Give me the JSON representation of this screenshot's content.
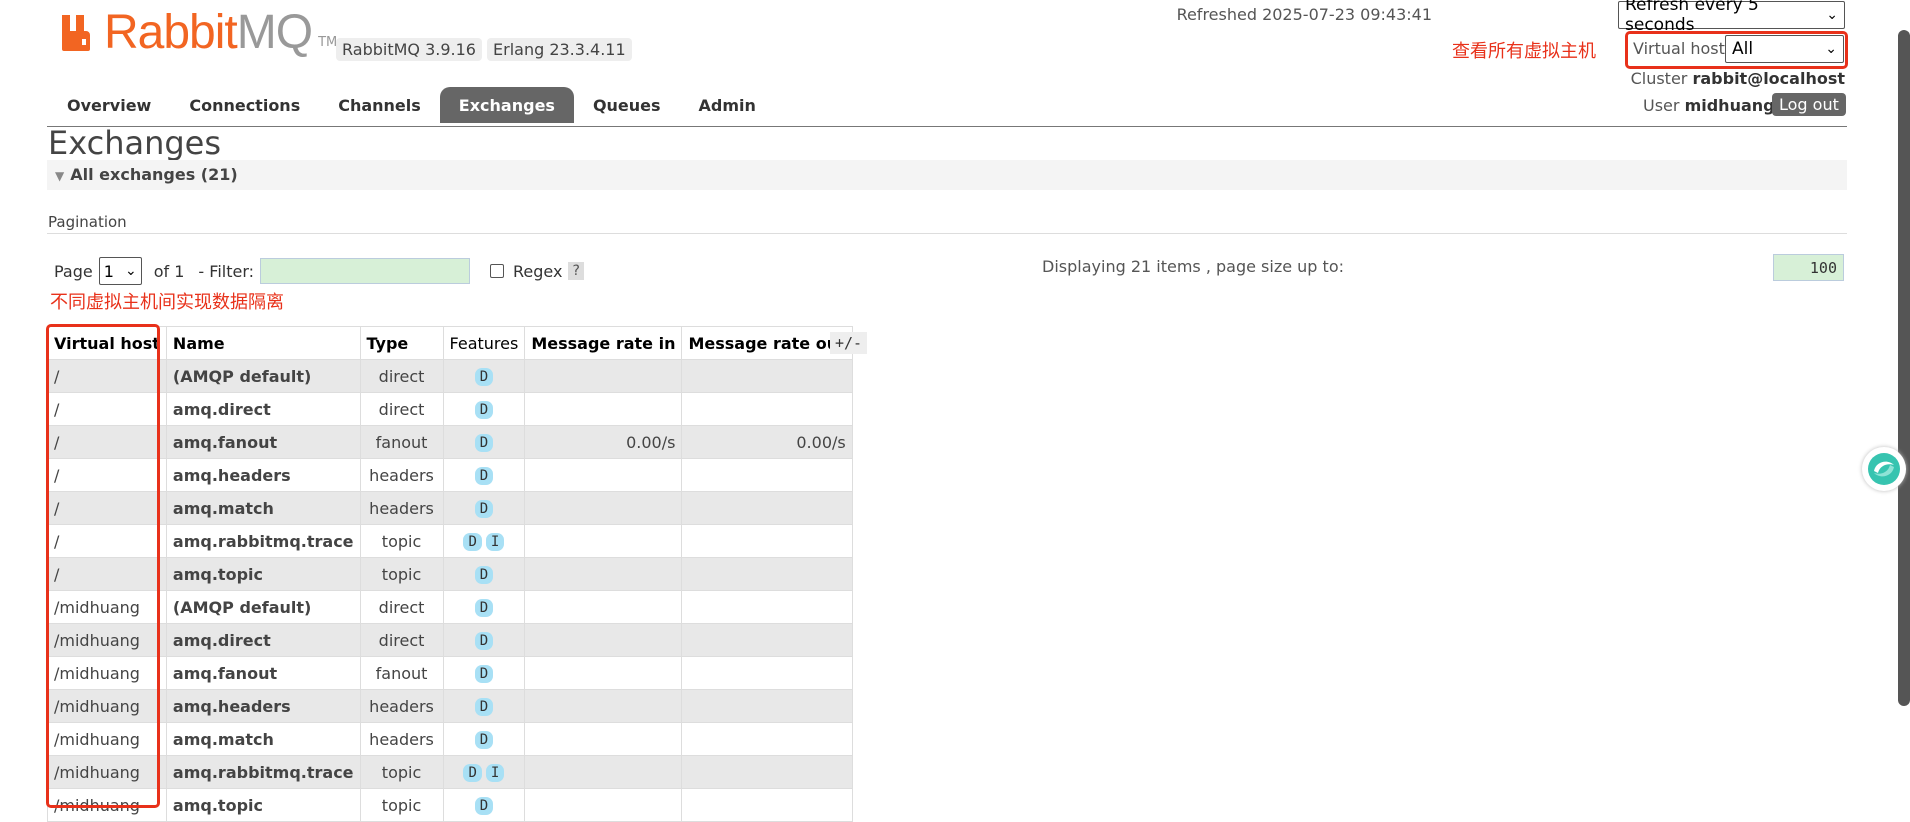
{
  "app": {
    "logo_prefix": "Rabbit",
    "logo_suffix": "MQ",
    "logo_tm": "TM",
    "version_badge": "RabbitMQ 3.9.16",
    "erlang_badge": "Erlang 23.3.4.11"
  },
  "header": {
    "refreshed_text": "Refreshed 2025-07-23 09:43:41",
    "refresh_select_value": "Refresh every 5 seconds",
    "annotation_vhost": "查看所有虚拟主机",
    "vhost_label": "Virtual host",
    "vhost_value": "All",
    "cluster_label": "Cluster",
    "cluster_value": "rabbit@localhost",
    "user_label": "User",
    "user_value": "midhuang",
    "logout_label": "Log out"
  },
  "tabs": [
    {
      "label": "Overview"
    },
    {
      "label": "Connections"
    },
    {
      "label": "Channels"
    },
    {
      "label": "Exchanges",
      "active": true
    },
    {
      "label": "Queues"
    },
    {
      "label": "Admin"
    }
  ],
  "page": {
    "title": "Exchanges",
    "section_label": "All exchanges (21)",
    "pagination_label": "Pagination",
    "page_label": "Page",
    "page_value": "1",
    "of_label": "of 1",
    "filter_label": "- Filter:",
    "regex_label": "Regex",
    "help_label": "?",
    "display_info": "Displaying 21 items , page size up to:",
    "page_size_value": "100",
    "annotation_isolation": "不同虚拟主机间实现数据隔离",
    "plus_minus": "+/-"
  },
  "table": {
    "headers": [
      "Virtual host",
      "Name",
      "Type",
      "Features",
      "Message rate in",
      "Message rate out"
    ],
    "rows": [
      {
        "vhost": "/",
        "name": "(AMQP default)",
        "type": "direct",
        "features": [
          "D"
        ],
        "rate_in": "",
        "rate_out": ""
      },
      {
        "vhost": "/",
        "name": "amq.direct",
        "type": "direct",
        "features": [
          "D"
        ],
        "rate_in": "",
        "rate_out": ""
      },
      {
        "vhost": "/",
        "name": "amq.fanout",
        "type": "fanout",
        "features": [
          "D"
        ],
        "rate_in": "0.00/s",
        "rate_out": "0.00/s"
      },
      {
        "vhost": "/",
        "name": "amq.headers",
        "type": "headers",
        "features": [
          "D"
        ],
        "rate_in": "",
        "rate_out": ""
      },
      {
        "vhost": "/",
        "name": "amq.match",
        "type": "headers",
        "features": [
          "D"
        ],
        "rate_in": "",
        "rate_out": ""
      },
      {
        "vhost": "/",
        "name": "amq.rabbitmq.trace",
        "type": "topic",
        "features": [
          "D",
          "I"
        ],
        "rate_in": "",
        "rate_out": ""
      },
      {
        "vhost": "/",
        "name": "amq.topic",
        "type": "topic",
        "features": [
          "D"
        ],
        "rate_in": "",
        "rate_out": ""
      },
      {
        "vhost": "/midhuang",
        "name": "(AMQP default)",
        "type": "direct",
        "features": [
          "D"
        ],
        "rate_in": "",
        "rate_out": ""
      },
      {
        "vhost": "/midhuang",
        "name": "amq.direct",
        "type": "direct",
        "features": [
          "D"
        ],
        "rate_in": "",
        "rate_out": ""
      },
      {
        "vhost": "/midhuang",
        "name": "amq.fanout",
        "type": "fanout",
        "features": [
          "D"
        ],
        "rate_in": "",
        "rate_out": ""
      },
      {
        "vhost": "/midhuang",
        "name": "amq.headers",
        "type": "headers",
        "features": [
          "D"
        ],
        "rate_in": "",
        "rate_out": ""
      },
      {
        "vhost": "/midhuang",
        "name": "amq.match",
        "type": "headers",
        "features": [
          "D"
        ],
        "rate_in": "",
        "rate_out": ""
      },
      {
        "vhost": "/midhuang",
        "name": "amq.rabbitmq.trace",
        "type": "topic",
        "features": [
          "D",
          "I"
        ],
        "rate_in": "",
        "rate_out": ""
      },
      {
        "vhost": "/midhuang",
        "name": "amq.topic",
        "type": "topic",
        "features": [
          "D"
        ],
        "rate_in": "",
        "rate_out": ""
      }
    ]
  },
  "colors": {
    "brand_orange": "#f26522",
    "annotation_red": "#e8311a",
    "tab_active_bg": "#666666",
    "feature_pill": "#a8e0f5",
    "input_green": "#d7f0d7"
  },
  "icons": {
    "logo": "rabbit-logo-icon",
    "select_chevron": "chevron-down-icon",
    "section_toggle": "triangle-down-icon",
    "assistant": "assistant-swirl-icon"
  }
}
